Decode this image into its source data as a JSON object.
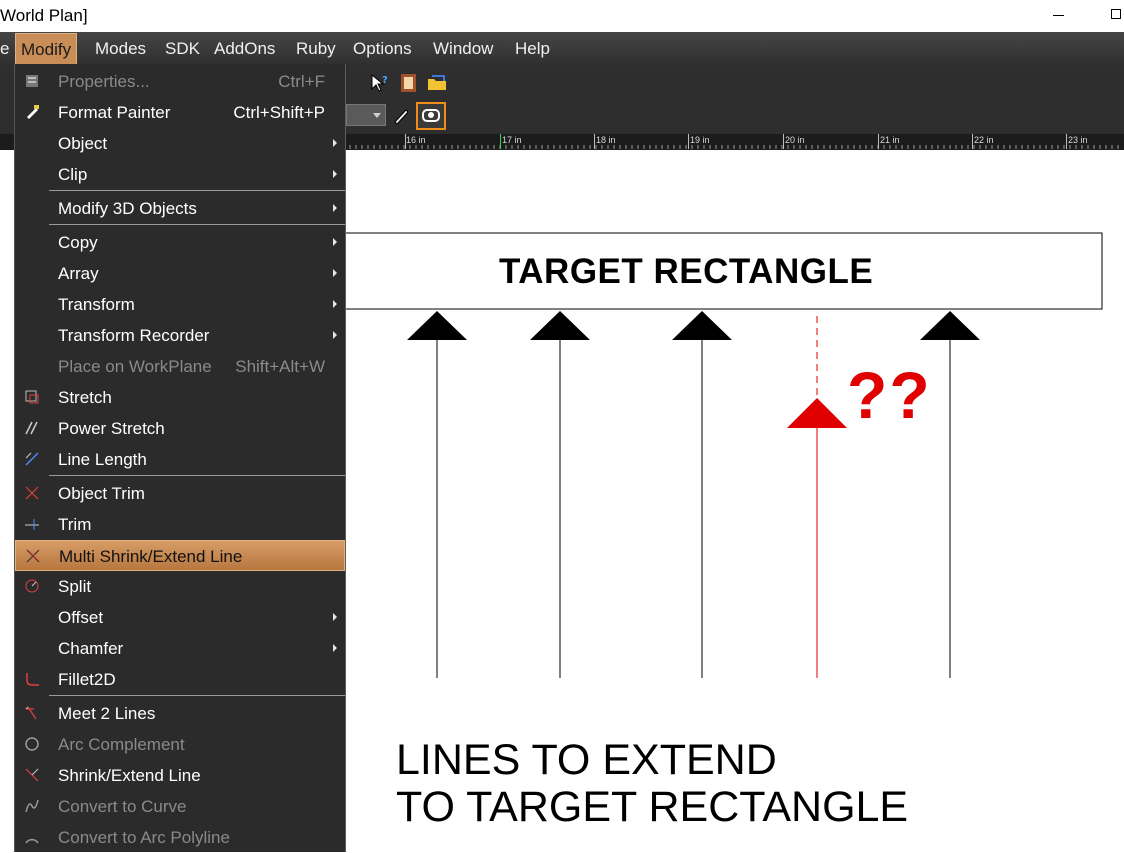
{
  "window": {
    "title": "World Plan]"
  },
  "menubar": {
    "items": [
      {
        "id": "file",
        "label": "e"
      },
      {
        "id": "modify",
        "label": "Modify"
      },
      {
        "id": "modes",
        "label": "Modes"
      },
      {
        "id": "sdk",
        "label": "SDK"
      },
      {
        "id": "addons",
        "label": "AddOns"
      },
      {
        "id": "ruby",
        "label": "Ruby"
      },
      {
        "id": "options",
        "label": "Options"
      },
      {
        "id": "window",
        "label": "Window"
      },
      {
        "id": "help",
        "label": "Help"
      }
    ],
    "active": "Modify"
  },
  "ruler": {
    "labels": [
      "16 in",
      "17 in",
      "18 in",
      "19 in",
      "20 in",
      "21 in",
      "22 in",
      "23 in"
    ]
  },
  "modify_menu": {
    "items": [
      {
        "label": "Properties...",
        "shortcut": "Ctrl+F",
        "disabled": true,
        "icon": "properties-icon"
      },
      {
        "label": "Format Painter",
        "shortcut": "Ctrl+Shift+P",
        "icon": "format-painter-icon"
      },
      {
        "label": "Object",
        "submenu": true
      },
      {
        "label": "Clip",
        "submenu": true
      },
      {
        "label": "Modify 3D Objects",
        "submenu": true
      },
      {
        "label": "Copy",
        "submenu": true
      },
      {
        "label": "Array",
        "submenu": true
      },
      {
        "label": "Transform",
        "submenu": true
      },
      {
        "label": "Transform Recorder",
        "submenu": true
      },
      {
        "label": "Place on WorkPlane",
        "shortcut": "Shift+Alt+W",
        "disabled": true
      },
      {
        "label": "Stretch",
        "icon": "stretch-icon"
      },
      {
        "label": "Power Stretch",
        "icon": "power-stretch-icon"
      },
      {
        "label": "Line Length",
        "icon": "line-length-icon"
      },
      {
        "label": "Object Trim",
        "icon": "object-trim-icon"
      },
      {
        "label": "Trim",
        "icon": "trim-icon"
      },
      {
        "label": "Multi Shrink/Extend Line",
        "icon": "multi-shrink-extend-icon",
        "highlighted": true
      },
      {
        "label": "Split",
        "icon": "split-icon"
      },
      {
        "label": "Offset",
        "submenu": true
      },
      {
        "label": "Chamfer",
        "submenu": true
      },
      {
        "label": "Fillet2D",
        "icon": "fillet-icon"
      },
      {
        "label": "Meet 2 Lines",
        "icon": "meet-lines-icon"
      },
      {
        "label": "Arc Complement",
        "icon": "arc-complement-icon",
        "disabled": true
      },
      {
        "label": "Shrink/Extend Line",
        "icon": "shrink-extend-icon"
      },
      {
        "label": "Convert to Curve",
        "icon": "convert-curve-icon",
        "disabled": true
      },
      {
        "label": "Convert to Arc Polyline",
        "icon": "convert-arc-polyline-icon",
        "disabled": true
      }
    ]
  },
  "drawing": {
    "target_label": "TARGET RECTANGLE",
    "question_marks": "??",
    "caption_line1": "LINES TO EXTEND",
    "caption_line2": "TO TARGET RECTANGLE",
    "colors": {
      "lines": "#000000",
      "problem_line": "#e00000"
    }
  }
}
